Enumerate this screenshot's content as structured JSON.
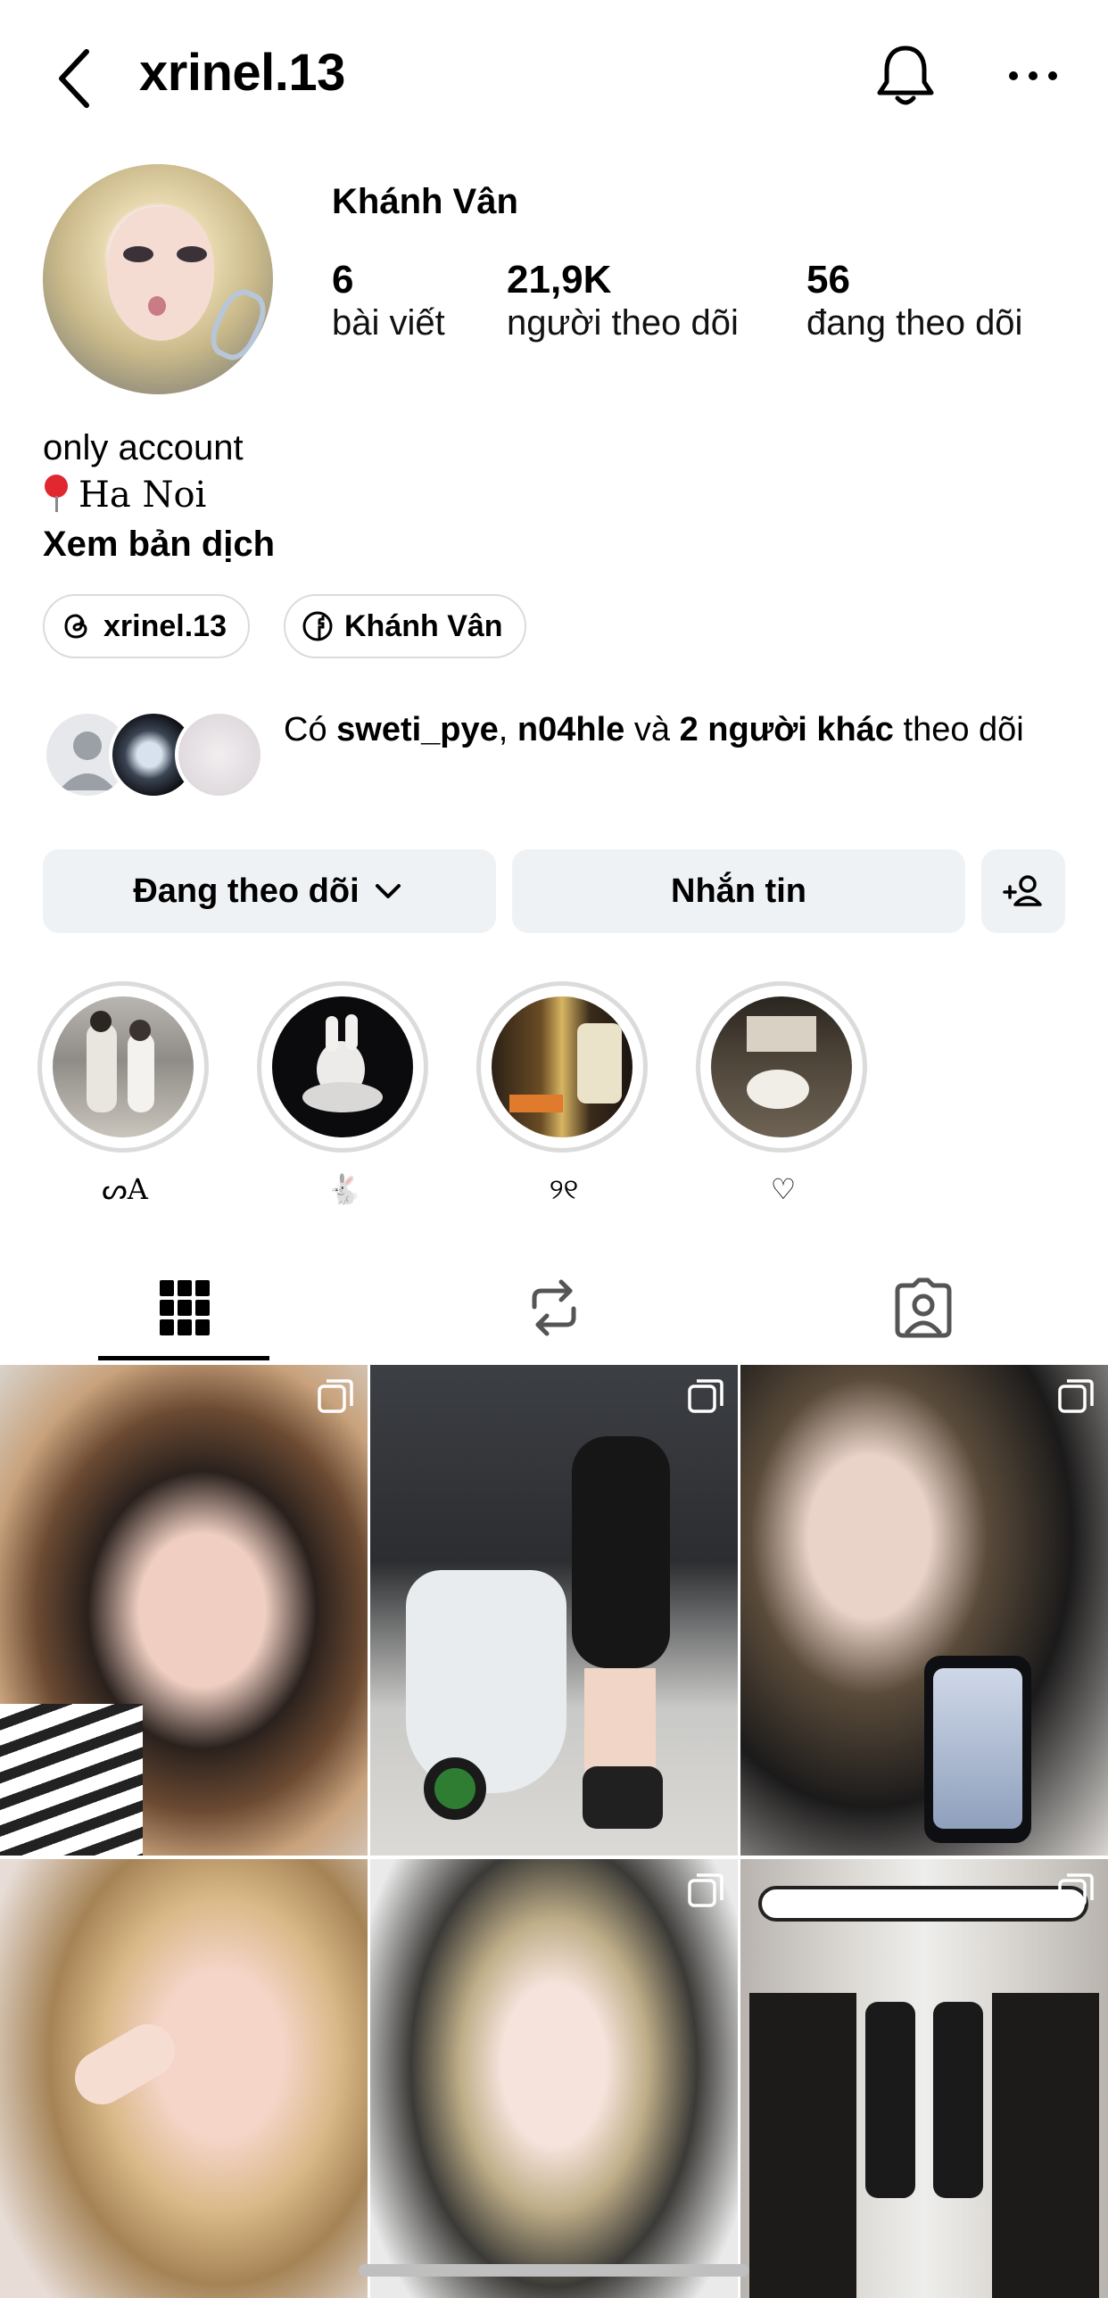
{
  "header": {
    "username": "xrinel.13"
  },
  "profile": {
    "display_name": "Khánh Vân",
    "stats": [
      {
        "value": "6",
        "label": "bài viết"
      },
      {
        "value": "21,9K",
        "label": "người theo dõi"
      },
      {
        "value": "56",
        "label": "đang theo dõi"
      }
    ],
    "bio_line1": "only account",
    "bio_location": "Ha Noi",
    "translate_link": "Xem bản dịch"
  },
  "links": [
    {
      "icon": "threads-icon",
      "label": "xrinel.13"
    },
    {
      "icon": "facebook-icon",
      "label": "Khánh Vân"
    }
  ],
  "mutual": {
    "prefix": "Có ",
    "user1": "sweti_pye",
    "sep": ", ",
    "user2": "n04hle",
    "and": " và ",
    "others": "2 người khác",
    "suffix": " theo dõi"
  },
  "actions": {
    "following_label": "Đang theo dõi",
    "message_label": "Nhắn tin"
  },
  "highlights": [
    {
      "caption": "ᔕA"
    },
    {
      "caption": "🐇"
    },
    {
      "caption": "୨୧"
    },
    {
      "caption": "♡"
    }
  ],
  "tabs": [
    "posts-grid-icon",
    "reposts-icon",
    "tagged-icon"
  ],
  "colors": {
    "button_bg": "#eff2f5",
    "ring": "#dbdbdb",
    "pin_red": "#e1272f"
  }
}
